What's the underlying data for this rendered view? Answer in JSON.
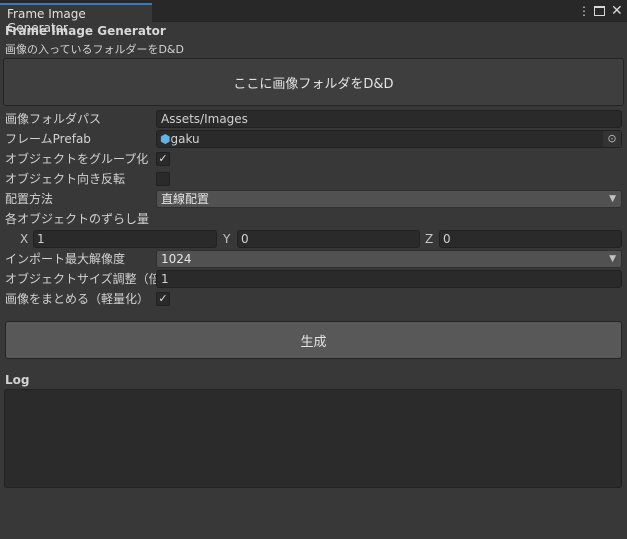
{
  "window": {
    "tab_title": "Frame Image Generator"
  },
  "header": {
    "title": "Frame Image Generator",
    "subtitle": "画像の入っているフォルダーをD&D"
  },
  "drop_area": {
    "label": "ここに画像フォルダをD&D"
  },
  "fields": {
    "folder_path": {
      "label": "画像フォルダパス",
      "value": "Assets/Images"
    },
    "frame_prefab": {
      "label": "フレームPrefab",
      "value": "gaku"
    },
    "group_objects": {
      "label": "オブジェクトをグループ化",
      "checked": true
    },
    "flip_orientation": {
      "label": "オブジェクト向き反転",
      "checked": false
    },
    "placement": {
      "label": "配置方法",
      "value": "直線配置"
    },
    "offset": {
      "label": "各オブジェクトのずらし量",
      "x_label": "X",
      "x": "1",
      "y_label": "Y",
      "y": "0",
      "z_label": "Z",
      "z": "0"
    },
    "import_max_res": {
      "label": "インポート最大解像度",
      "value": "1024"
    },
    "size_scale": {
      "label": "オブジェクトサイズ調整（倍率）",
      "value": "1"
    },
    "combine_images": {
      "label": "画像をまとめる（軽量化）",
      "checked": true
    }
  },
  "generate_button": {
    "label": "生成"
  },
  "log": {
    "label": "Log",
    "content": ""
  }
}
